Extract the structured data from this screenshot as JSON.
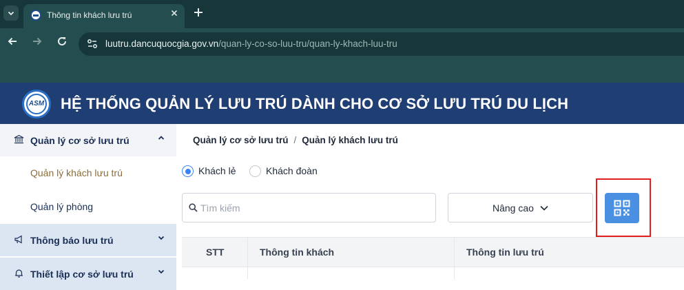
{
  "browser": {
    "tab_title": "Thông tin khách lưu trú",
    "url_host": "luutru.dancuquocgia.gov.vn",
    "url_path": "/quan-ly-co-so-luu-tru/quan-ly-khach-luu-tru",
    "icons": [
      "chevron-down-icon",
      "close-icon",
      "plus-icon",
      "back-arrow-icon",
      "forward-arrow-icon",
      "reload-icon",
      "site-settings-icon"
    ]
  },
  "header": {
    "logo_text": "ASM",
    "title": "HỆ THỐNG QUẢN LÝ LƯU TRÚ DÀNH CHO CƠ SỞ LƯU TRÚ DU LỊCH"
  },
  "sidebar": {
    "items": [
      {
        "label": "Quản lý cơ sở lưu trú",
        "icon": "bank-icon",
        "expanded": true
      },
      {
        "label": "Quản lý khách lưu trú",
        "active": true
      },
      {
        "label": "Quản lý phòng"
      },
      {
        "label": "Thông báo lưu trú",
        "icon": "megaphone-icon"
      },
      {
        "label": "Thiết lập cơ sở lưu trú",
        "icon": "bell-icon"
      }
    ]
  },
  "breadcrumb": {
    "parent": "Quản lý cơ sở lưu trú",
    "separator": "/",
    "current": "Quản lý khách lưu trú"
  },
  "guest_type": {
    "options": [
      "Khách lẻ",
      "Khách đoàn"
    ],
    "selected": "Khách lẻ"
  },
  "search": {
    "placeholder": "Tìm kiếm",
    "value": ""
  },
  "advanced_button": {
    "label": "Nâng cao"
  },
  "qr_button": {
    "icon": "qr-code-icon"
  },
  "table": {
    "columns": [
      "STT",
      "Thông tin khách",
      "Thông tin lưu trú"
    ]
  },
  "colors": {
    "chrome_dark": "#16363a",
    "chrome": "#234d4f",
    "header_bg": "#1f3f74",
    "accent": "#4a90e2",
    "highlight": "#e11d1d",
    "active_menu": "#8a6d3b"
  }
}
